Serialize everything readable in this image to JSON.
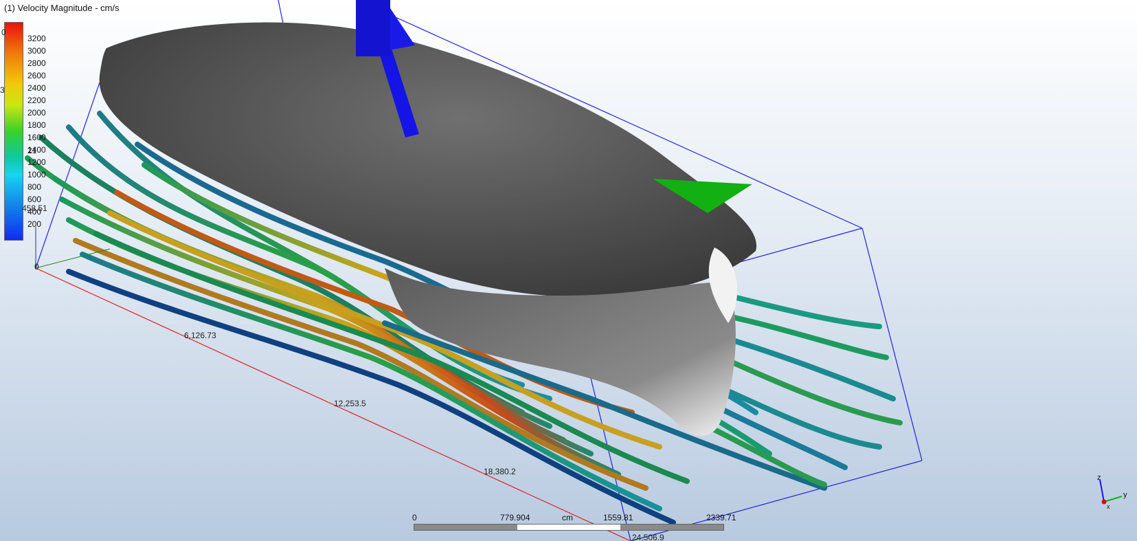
{
  "legend": {
    "title": "(1) Velocity Magnitude - cm/s",
    "ticks": [
      "3200",
      "3000",
      "2800",
      "2600",
      "2400",
      "2200",
      "2000",
      "1800",
      "1600",
      "1400",
      "1200",
      "1000",
      "800",
      "600",
      "400",
      "200"
    ],
    "overlay_labels": [
      "0",
      "3",
      "21",
      "458.51"
    ]
  },
  "axes": {
    "origin": "0",
    "ticks": [
      "6,126.73",
      "12,253.5",
      "18,380.2",
      "24,506.9"
    ]
  },
  "scale_bar": {
    "labels": [
      "0",
      "779.904",
      "cm",
      "1559.81",
      "2339.71"
    ]
  },
  "triad": {
    "z": "z",
    "y": "y",
    "x": "x"
  },
  "colors": {
    "body": "#5a5a5a",
    "arrow_lift": "#1414e6",
    "arrow_drag": "#12b012",
    "bounding_box": "#2222dd"
  }
}
